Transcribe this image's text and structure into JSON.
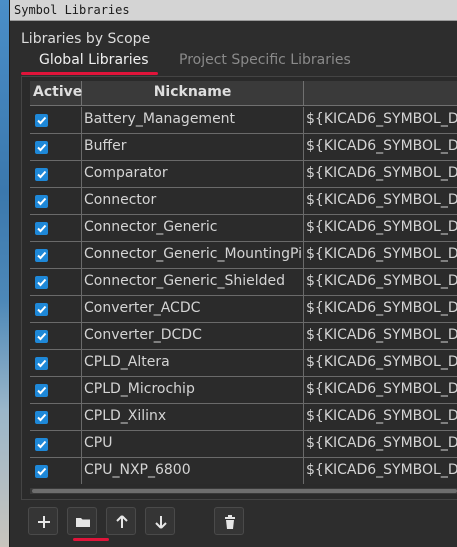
{
  "window": {
    "title": "Symbol Libraries"
  },
  "scope_label": "Libraries by Scope",
  "tabs": [
    {
      "label": "Global Libraries",
      "active": true
    },
    {
      "label": "Project Specific Libraries",
      "active": false
    }
  ],
  "table": {
    "headers": {
      "active": "Active",
      "nickname": "Nickname",
      "path": ""
    },
    "rows": [
      {
        "active": true,
        "nickname": "Battery_Management",
        "path": "${KICAD6_SYMBOL_D"
      },
      {
        "active": true,
        "nickname": "Buffer",
        "path": "${KICAD6_SYMBOL_D"
      },
      {
        "active": true,
        "nickname": "Comparator",
        "path": "${KICAD6_SYMBOL_D"
      },
      {
        "active": true,
        "nickname": "Connector",
        "path": "${KICAD6_SYMBOL_D"
      },
      {
        "active": true,
        "nickname": "Connector_Generic",
        "path": "${KICAD6_SYMBOL_D"
      },
      {
        "active": true,
        "nickname": "Connector_Generic_MountingPin",
        "path": "${KICAD6_SYMBOL_D"
      },
      {
        "active": true,
        "nickname": "Connector_Generic_Shielded",
        "path": "${KICAD6_SYMBOL_D"
      },
      {
        "active": true,
        "nickname": "Converter_ACDC",
        "path": "${KICAD6_SYMBOL_D"
      },
      {
        "active": true,
        "nickname": "Converter_DCDC",
        "path": "${KICAD6_SYMBOL_D"
      },
      {
        "active": true,
        "nickname": "CPLD_Altera",
        "path": "${KICAD6_SYMBOL_D"
      },
      {
        "active": true,
        "nickname": "CPLD_Microchip",
        "path": "${KICAD6_SYMBOL_D"
      },
      {
        "active": true,
        "nickname": "CPLD_Xilinx",
        "path": "${KICAD6_SYMBOL_D"
      },
      {
        "active": true,
        "nickname": "CPU",
        "path": "${KICAD6_SYMBOL_D"
      },
      {
        "active": true,
        "nickname": "CPU_NXP_6800",
        "path": "${KICAD6_SYMBOL_D"
      }
    ]
  },
  "toolbar": {
    "buttons": [
      {
        "icon": "plus-icon"
      },
      {
        "icon": "folder-icon"
      },
      {
        "icon": "arrow-up-icon"
      },
      {
        "icon": "arrow-down-icon"
      },
      {
        "icon": "trash-icon"
      }
    ]
  },
  "colors": {
    "accent": "#e0143a",
    "checkbox": "#1e88d8"
  }
}
